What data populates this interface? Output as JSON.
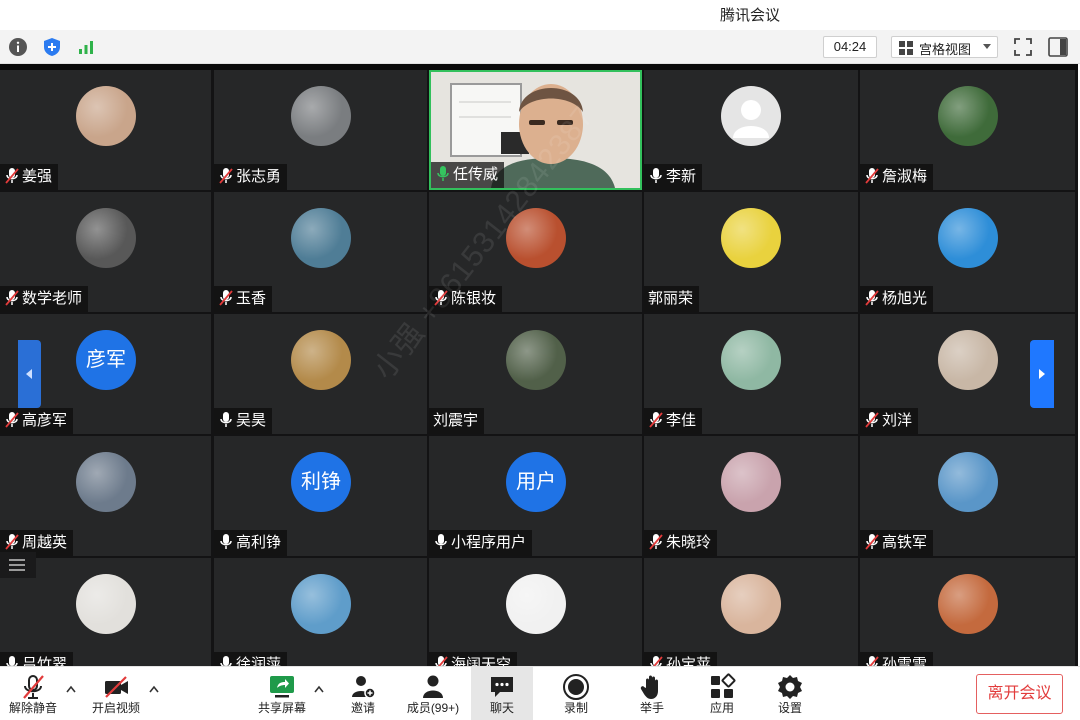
{
  "window": {
    "title": "腾讯会议"
  },
  "infobar": {
    "timer": "04:24",
    "view_mode": "宫格视图"
  },
  "watermark": "小强 +86153142842387",
  "participants": [
    {
      "name": "姜强",
      "mic": "muted",
      "avatar": "photo",
      "color": "#c9a58b"
    },
    {
      "name": "张志勇",
      "mic": "muted",
      "avatar": "photo",
      "color": "#7a7d80"
    },
    {
      "name": "任传威",
      "mic": "speaking",
      "avatar": "video",
      "color": "#e8e6e1"
    },
    {
      "name": "李新",
      "mic": "on",
      "avatar": "default",
      "color": "#e5e5e5"
    },
    {
      "name": "詹淑梅",
      "mic": "muted",
      "avatar": "photo",
      "color": "#3f6b3a"
    },
    {
      "name": "数学老师",
      "mic": "muted",
      "avatar": "photo",
      "color": "#585858"
    },
    {
      "name": "玉香",
      "mic": "muted",
      "avatar": "photo",
      "color": "#4f7d96"
    },
    {
      "name": "陈银妆",
      "mic": "muted",
      "avatar": "photo",
      "color": "#b9502f"
    },
    {
      "name": "郭丽荣",
      "mic": "none",
      "avatar": "photo",
      "color": "#e9d23e"
    },
    {
      "name": "杨旭光",
      "mic": "muted",
      "avatar": "photo",
      "color": "#2e8ed8"
    },
    {
      "name": "高彦军",
      "mic": "muted",
      "avatar": "text",
      "avatar_text": "彦军",
      "color": "#1f73e6"
    },
    {
      "name": "吴昊",
      "mic": "on",
      "avatar": "photo",
      "color": "#b38a4a"
    },
    {
      "name": "刘震宇",
      "mic": "none",
      "avatar": "photo",
      "color": "#516049"
    },
    {
      "name": "李佳",
      "mic": "muted",
      "avatar": "photo",
      "color": "#8fb8a3"
    },
    {
      "name": "刘洋",
      "mic": "muted",
      "avatar": "photo",
      "color": "#c8b7a6"
    },
    {
      "name": "周越英",
      "mic": "muted",
      "avatar": "photo",
      "color": "#6d7b8c"
    },
    {
      "name": "高利铮",
      "mic": "on",
      "avatar": "text",
      "avatar_text": "利铮",
      "color": "#1f73e6"
    },
    {
      "name": "小程序用户",
      "mic": "on",
      "avatar": "text",
      "avatar_text": "用户",
      "color": "#1f73e6"
    },
    {
      "name": "朱晓玲",
      "mic": "muted",
      "avatar": "photo",
      "color": "#c9a3ad"
    },
    {
      "name": "高铁军",
      "mic": "muted",
      "avatar": "photo",
      "color": "#5a96c8"
    },
    {
      "name": "吕竹翠",
      "mic": "on",
      "avatar": "photo",
      "color": "#e2e0dc"
    },
    {
      "name": "徐润萍",
      "mic": "on",
      "avatar": "photo",
      "color": "#5f9dca"
    },
    {
      "name": "海阔天空",
      "mic": "muted",
      "avatar": "photo",
      "color": "#f1f1f1"
    },
    {
      "name": "孙宝苹",
      "mic": "muted",
      "avatar": "photo",
      "color": "#d9b59d"
    },
    {
      "name": "孙雪雪",
      "mic": "muted",
      "avatar": "photo",
      "color": "#c46a3e"
    }
  ],
  "toolbar": {
    "unmute": "解除静音",
    "start_video": "开启视频",
    "share_screen": "共享屏幕",
    "invite": "邀请",
    "members": "成员(99+)",
    "chat": "聊天",
    "record": "录制",
    "raise_hand": "举手",
    "apps": "应用",
    "settings": "设置",
    "leave": "离开会议"
  },
  "colors": {
    "speaking_border": "#33c05c",
    "avatar_blue": "#1f73e6",
    "leave_red": "#e23b3b",
    "nav_blue": "#1f78ff"
  }
}
